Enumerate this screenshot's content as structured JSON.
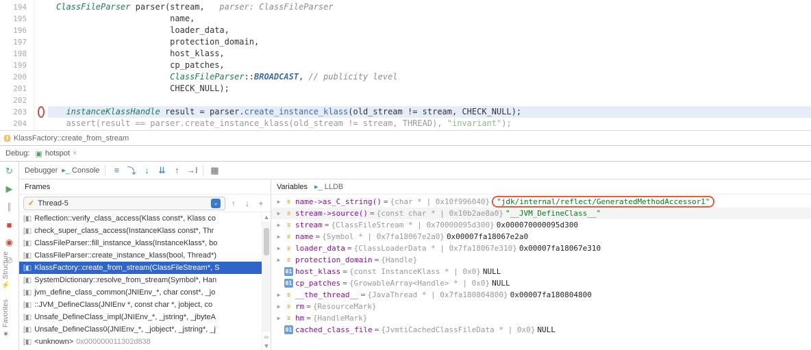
{
  "editor": {
    "lines": [
      {
        "num": "194",
        "html": "<span class='type'>ClassFileParser</span> parser(stream,   <span class='ital'>parser: ClassFileParser</span>"
      },
      {
        "num": "195",
        "html": "                       name,"
      },
      {
        "num": "196",
        "html": "                       loader_data,"
      },
      {
        "num": "197",
        "html": "                       protection_domain,"
      },
      {
        "num": "198",
        "html": "                       host_klass,"
      },
      {
        "num": "199",
        "html": "                       cp_patches,"
      },
      {
        "num": "200",
        "html": "                       <span class='type'>ClassFileParser</span>::<span class='boldital'>BROADCAST</span>, <span class='comm'>// publicity level</span>"
      },
      {
        "num": "201",
        "html": "                       CHECK_NULL);"
      },
      {
        "num": "202",
        "html": ""
      },
      {
        "num": "203",
        "html": "  <span class='type'>instanceKlassHandle</span> result = parser.<span class='call'>create_instance_klass</span>(old_stream != stream, CHECK_NULL);",
        "hl": true,
        "bp": true
      },
      {
        "num": "204",
        "html": "  assert(result == parser.create_instance_klass(old_stream != stream, THREAD), <span class='str'>\"invariant\"</span>);",
        "dim": true
      }
    ]
  },
  "crumb": {
    "text": "KlassFactory::create_from_stream"
  },
  "debugHeader": {
    "label": "Debug:",
    "config": "hotspot"
  },
  "topToolbar": {
    "debuggerLabel": "Debugger",
    "consoleLabel": "Console"
  },
  "framesPanel": {
    "title": "Frames",
    "thread": "Thread-5",
    "frames": [
      {
        "text": "Reflection::verify_class_access(Klass const*, Klass co"
      },
      {
        "text": "check_super_class_access(InstanceKlass const*, Thr"
      },
      {
        "text": "ClassFileParser::fill_instance_klass(InstanceKlass*, bo"
      },
      {
        "text": "ClassFileParser::create_instance_klass(bool, Thread*)"
      },
      {
        "text": "KlassFactory::create_from_stream(ClassFileStream*, S",
        "selected": true
      },
      {
        "text": "SystemDictionary::resolve_from_stream(Symbol*, Han"
      },
      {
        "text": "jvm_define_class_common(JNIEnv_*, char const*, _jo"
      },
      {
        "text": "::JVM_DefineClass(JNIEnv *, const char *, jobject, co"
      },
      {
        "text": "Unsafe_DefineClass_impl(JNIEnv_*, _jstring*, _jbyteA"
      },
      {
        "text": "Unsafe_DefineClass0(JNIEnv_*, _jobject*, _jstring*, _j"
      },
      {
        "text": "<unknown>",
        "addr": "0x000000011302d838"
      }
    ]
  },
  "varsPanel": {
    "title": "Variables",
    "lldb": "LLDB",
    "rows": [
      {
        "badge": "stack",
        "name": "name->as_C_string()",
        "type": "{char * | 0x10f996040}",
        "val": "\"jdk/internal/reflect/GeneratedMethodAccessor1\"",
        "hl": true,
        "tri": true
      },
      {
        "badge": "stack",
        "name": "stream->source()",
        "type": "{const char * | 0x10b2ae8a0}",
        "val": "\"__JVM_DefineClass__\"",
        "tri": true,
        "shade": true
      },
      {
        "badge": "stack",
        "name": "stream",
        "type": "{ClassFileStream * | 0x70000095d300}",
        "val": "0x000070000095d300",
        "tri": true
      },
      {
        "badge": "stack",
        "name": "name",
        "type": "{Symbol * | 0x7fa18067e2a0}",
        "val": "0x00007fa18067e2a0",
        "tri": true
      },
      {
        "badge": "stack",
        "name": "loader_data",
        "type": "{ClassLoaderData * | 0x7fa18067e310}",
        "val": "0x00007fa18067e310",
        "tri": true
      },
      {
        "badge": "stack",
        "name": "protection_domain",
        "type": "{Handle}",
        "val": "",
        "tri": true
      },
      {
        "badge": "01",
        "name": "host_klass",
        "type": "{const InstanceKlass * | 0x0}",
        "val": "NULL"
      },
      {
        "badge": "01",
        "name": "cp_patches",
        "type": "{GrowableArray<Handle> * | 0x0}",
        "val": "NULL"
      },
      {
        "badge": "stack",
        "name": "__the_thread__",
        "type": "{JavaThread * | 0x7fa180804800}",
        "val": "0x00007fa180804800",
        "tri": true
      },
      {
        "badge": "stack",
        "name": "rm",
        "type": "{ResourceMark}",
        "val": "",
        "tri": true
      },
      {
        "badge": "stack",
        "name": "hm",
        "type": "{HandleMark}",
        "val": "",
        "tri": true
      },
      {
        "badge": "01",
        "name": "cached_class_file",
        "type": "{JvmtiCachedClassFileData * | 0x0}",
        "val": "NULL"
      }
    ]
  },
  "sideTabs": {
    "structure": "Structure",
    "favorites": "Favorites"
  }
}
